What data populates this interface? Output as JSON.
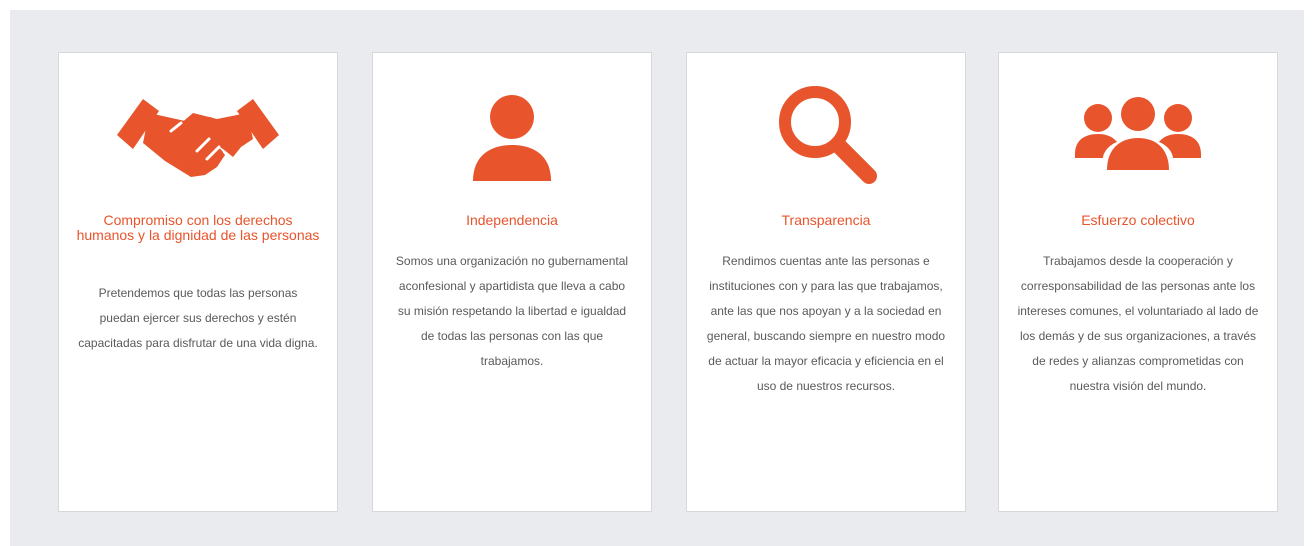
{
  "colors": {
    "accent": "#e8542c",
    "panel_background": "#e9ebee",
    "card_background": "#ffffff",
    "body_text": "#5a5a5a"
  },
  "cards": [
    {
      "icon": "handshake-icon",
      "title": "Compromiso con los derechos humanos y la dignidad de las personas",
      "body": "Pretendemos que todas las personas puedan ejercer sus derechos y estén capacitadas para disfrutar de una vida digna."
    },
    {
      "icon": "person-icon",
      "title": "Independencia",
      "body": "Somos una organización no gubernamental aconfesional y apartidista que lleva a cabo su misión respetando la libertad e igualdad de todas las personas con las que trabajamos."
    },
    {
      "icon": "magnifier-icon",
      "title": "Transparencia",
      "body": "Rendimos cuentas ante las personas e instituciones con y para las que trabajamos, ante las que nos apoyan y a la sociedad en general, buscando siempre en nuestro modo de actuar la mayor eficacia y eficiencia en el uso de nuestros recursos."
    },
    {
      "icon": "group-icon",
      "title": "Esfuerzo colectivo",
      "body": "Trabajamos desde la cooperación y corresponsabilidad de las personas ante los intereses comunes, el voluntariado al lado de los demás y de sus organizaciones, a través de redes y alianzas comprometidas con nuestra visión del mundo."
    }
  ]
}
